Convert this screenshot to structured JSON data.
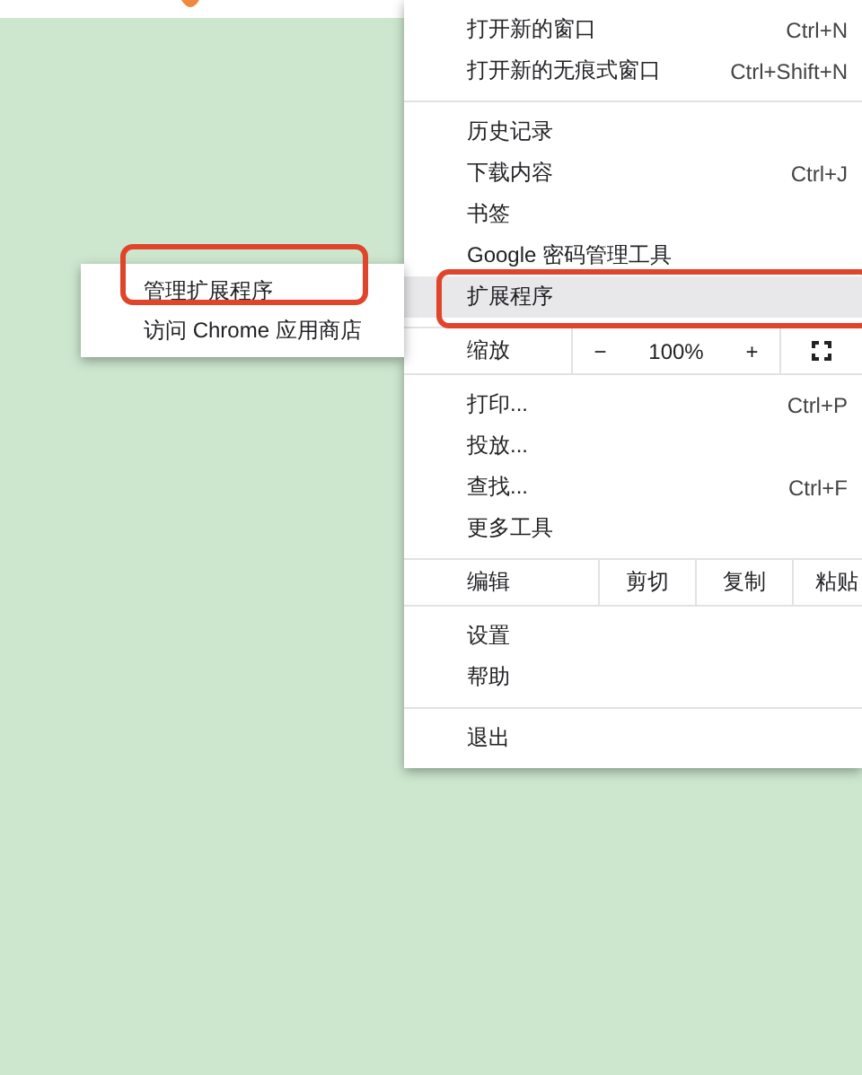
{
  "menu": {
    "sections": [
      {
        "items": [
          {
            "kind": "item",
            "label": "打开新的窗口",
            "shortcut": "Ctrl+N",
            "selected": false,
            "outlined": false
          },
          {
            "kind": "item",
            "label": "打开新的无痕式窗口",
            "shortcut": "Ctrl+Shift+N",
            "selected": false,
            "outlined": false
          }
        ]
      },
      {
        "items": [
          {
            "kind": "item",
            "label": "历史记录",
            "selected": false,
            "outlined": false
          },
          {
            "kind": "item",
            "label": "下载内容",
            "shortcut": "Ctrl+J",
            "selected": false,
            "outlined": false
          },
          {
            "kind": "item",
            "label": "书签",
            "selected": false,
            "outlined": false
          },
          {
            "kind": "item",
            "label": "Google 密码管理工具",
            "selected": false,
            "outlined": false
          },
          {
            "kind": "item",
            "label": "扩展程序",
            "selected": true,
            "outlined": true
          }
        ]
      },
      {
        "items": [
          {
            "kind": "zoom",
            "label": "缩放",
            "minus": "−",
            "value": "100%",
            "plus": "+"
          }
        ]
      },
      {
        "items": [
          {
            "kind": "item",
            "label": "打印...",
            "shortcut": "Ctrl+P",
            "selected": false,
            "outlined": false
          },
          {
            "kind": "item",
            "label": "投放...",
            "selected": false,
            "outlined": false
          },
          {
            "kind": "item",
            "label": "查找...",
            "shortcut": "Ctrl+F",
            "selected": false,
            "outlined": false
          },
          {
            "kind": "item",
            "label": "更多工具",
            "selected": false,
            "outlined": false
          }
        ]
      },
      {
        "items": [
          {
            "kind": "edit",
            "label": "编辑",
            "actions": [
              "剪切",
              "复制",
              "粘贴"
            ]
          }
        ]
      },
      {
        "items": [
          {
            "kind": "item",
            "label": "设置",
            "selected": false,
            "outlined": false
          },
          {
            "kind": "item",
            "label": "帮助",
            "selected": false,
            "outlined": false
          }
        ]
      },
      {
        "items": [
          {
            "kind": "item",
            "label": "退出",
            "selected": false,
            "outlined": false
          }
        ]
      }
    ]
  },
  "submenu": {
    "items": [
      {
        "label": "管理扩展程序",
        "outlined": true
      },
      {
        "label": "访问 Chrome 应用商店",
        "outlined": false
      }
    ]
  }
}
